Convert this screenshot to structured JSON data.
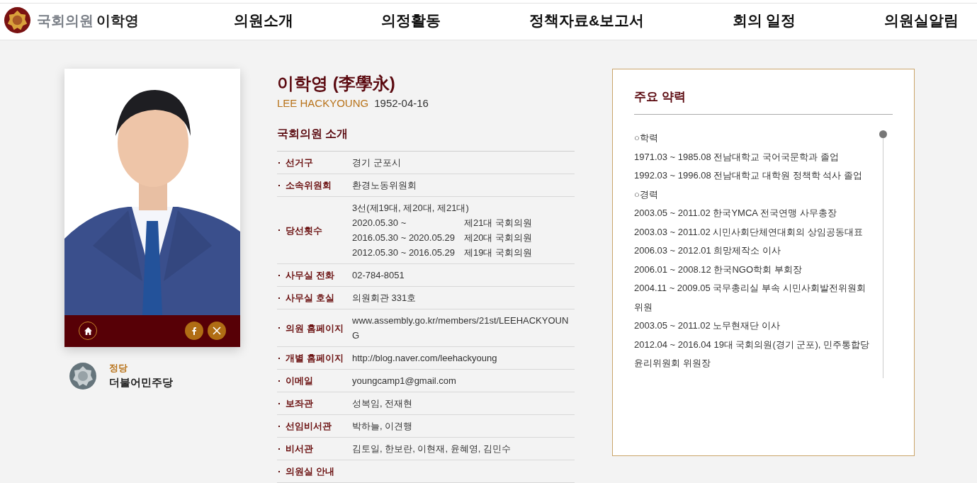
{
  "header": {
    "org": "국회의원",
    "name": "이학영",
    "nav": [
      "의원소개",
      "의정활동",
      "정책자료&보고서",
      "회의 일정",
      "의원실알림"
    ]
  },
  "profile": {
    "kind": "picture",
    "party_label": "정당",
    "party": "더불어민주당"
  },
  "member": {
    "name": "이학영 (李學永)",
    "english_name": "LEE HACKYOUNG",
    "birth": "1952-04-16",
    "section_title": "국회의원 소개",
    "rows": [
      {
        "kind": "text",
        "label": "선거구",
        "value": "경기 군포시"
      },
      {
        "kind": "text",
        "label": "소속위원회",
        "value": "환경노동위원회"
      },
      {
        "kind": "terms",
        "label": "당선횟수",
        "summary": "3선(제19대, 제20대, 제21대)",
        "terms": [
          {
            "period": "2020.05.30 ~",
            "term": "제21대 국회의원"
          },
          {
            "period": "2016.05.30 ~ 2020.05.29",
            "term": "제20대 국회의원"
          },
          {
            "period": "2012.05.30 ~ 2016.05.29",
            "term": "제19대 국회의원"
          }
        ]
      },
      {
        "kind": "text",
        "label": "사무실 전화",
        "value": "02-784-8051"
      },
      {
        "kind": "text",
        "label": "사무실 호실",
        "value": "의원회관 331호"
      },
      {
        "kind": "text",
        "label": "의원 홈페이지",
        "value": "www.assembly.go.kr/members/21st/LEEHACKYOUNG"
      },
      {
        "kind": "text",
        "label": "개별 홈페이지",
        "value": "http://blog.naver.com/leehackyoung"
      },
      {
        "kind": "text",
        "label": "이메일",
        "value": "youngcamp1@gmail.com"
      },
      {
        "kind": "text",
        "label": "보좌관",
        "value": "성복임, 전재현"
      },
      {
        "kind": "text",
        "label": "선임비서관",
        "value": "박하늘, 이견행"
      },
      {
        "kind": "text",
        "label": "비서관",
        "value": "김토일, 한보란, 이현재, 윤혜영, 김민수"
      },
      {
        "kind": "text",
        "label": "의원실 안내",
        "value": ""
      }
    ]
  },
  "career": {
    "title": "주요 약력",
    "lines": [
      "○학력",
      "1971.03 ~ 1985.08 전남대학교 국어국문학과 졸업",
      "1992.03 ~ 1996.08 전남대학교 대학원 정책학 석사 졸업",
      "○경력",
      "2003.05 ~ 2011.02 한국YMCA 전국연맹 사무총장",
      "2003.03 ~ 2011.02 시민사회단체연대회의 상임공동대표",
      "2006.03 ~ 2012.01 희망제작소 이사",
      "2006.01 ~ 2008.12 한국NGO학회 부회장",
      "2004.11 ~ 2009.05 국무총리실 부속 시민사회발전위원회 위원",
      "2003.05 ~ 2011.02 노무현재단 이사",
      "2012.04 ~ 2016.04 19대 국회의원(경기 군포), 민주통합당 윤리위원회 위원장"
    ]
  }
}
